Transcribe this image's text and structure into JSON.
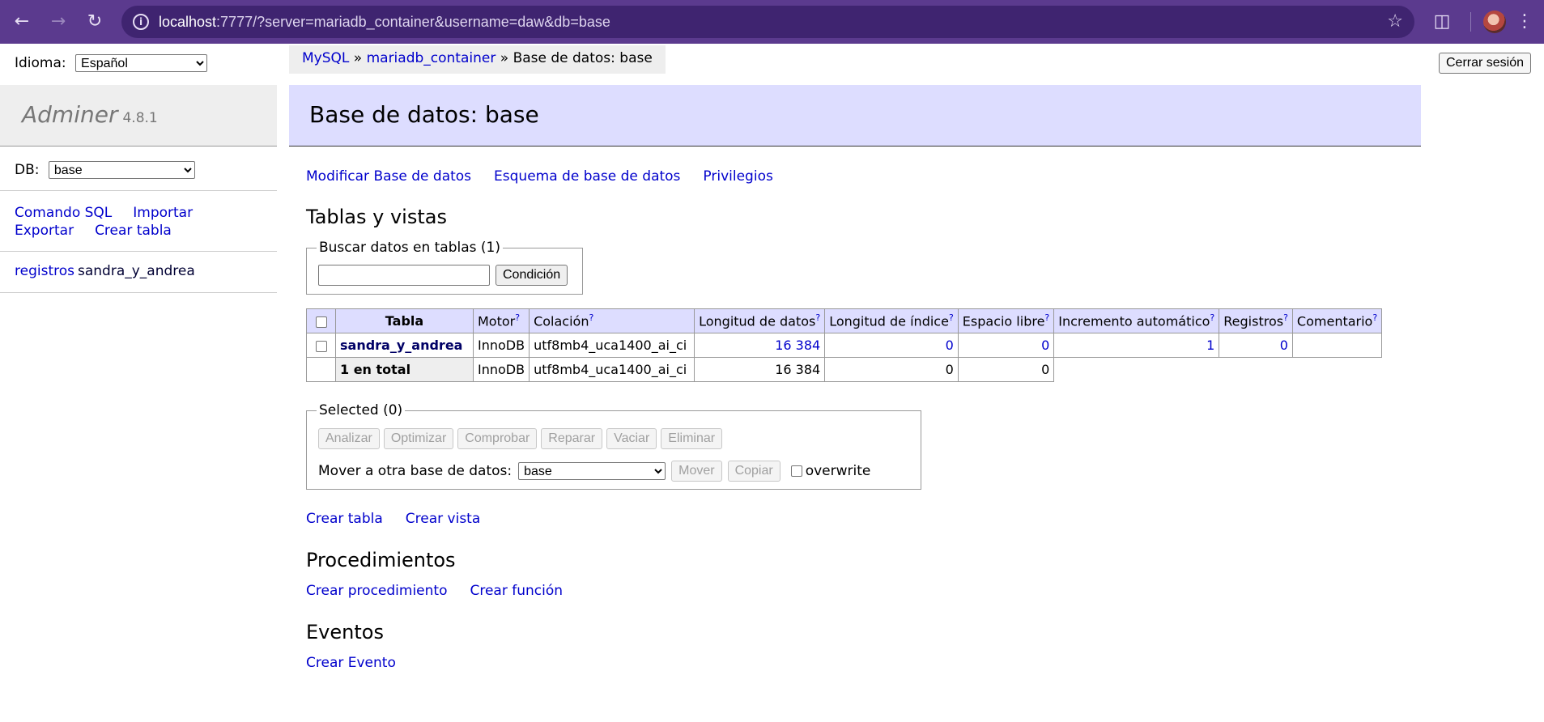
{
  "browser": {
    "url_host": "localhost",
    "url_rest": ":7777/?server=mariadb_container&username=daw&db=base"
  },
  "sidebar": {
    "language_label": "Idioma:",
    "language_value": "Español",
    "logo": "Adminer",
    "version": "4.8.1",
    "db_label": "DB:",
    "db_value": "base",
    "links": [
      "Comando SQL",
      "Importar",
      "Exportar",
      "Crear tabla"
    ],
    "table_action": "registros",
    "table_name": "sandra_y_andrea"
  },
  "breadcrumb": {
    "system": "MySQL",
    "sep1": "»",
    "server": "mariadb_container",
    "sep2": "»",
    "current": "Base de datos: base"
  },
  "logout_label": "Cerrar sesión",
  "header": {
    "title": "Base de datos: base"
  },
  "actions": [
    "Modificar Base de datos",
    "Esquema de base de datos",
    "Privilegios"
  ],
  "tables_section": {
    "title": "Tablas y vistas",
    "search_legend": "Buscar datos en tablas (1)",
    "search_button": "Condición",
    "columns": {
      "table": "Tabla",
      "engine": "Motor",
      "collation": "Colación",
      "data_length": "Longitud de datos",
      "index_length": "Longitud de índice",
      "data_free": "Espacio libre",
      "auto_increment": "Incremento automático",
      "rows": "Registros",
      "comment": "Comentario",
      "help_mark": "?"
    },
    "rows": [
      {
        "name": "sandra_y_andrea",
        "engine": "InnoDB",
        "collation": "utf8mb4_uca1400_ai_ci",
        "data_length": "16 384",
        "index_length": "0",
        "data_free": "0",
        "auto_increment": "1",
        "rows": "0",
        "comment": ""
      }
    ],
    "total": {
      "label": "1 en total",
      "engine": "InnoDB",
      "collation": "utf8mb4_uca1400_ai_ci",
      "data_length": "16 384",
      "index_length": "0",
      "data_free": "0"
    }
  },
  "selected": {
    "legend": "Selected (0)",
    "buttons": [
      "Analizar",
      "Optimizar",
      "Comprobar",
      "Reparar",
      "Vaciar",
      "Eliminar"
    ],
    "move_label": "Mover a otra base de datos:",
    "move_db": "base",
    "move_button": "Mover",
    "copy_button": "Copiar",
    "overwrite_label": "overwrite"
  },
  "create_links": [
    "Crear tabla",
    "Crear vista"
  ],
  "procedures": {
    "title": "Procedimientos",
    "links": [
      "Crear procedimiento",
      "Crear función"
    ]
  },
  "events": {
    "title": "Eventos",
    "link": "Crear Evento"
  }
}
